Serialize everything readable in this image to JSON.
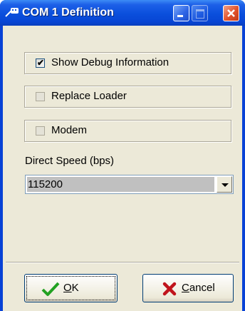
{
  "window": {
    "title": "COM 1 Definition"
  },
  "options": [
    {
      "label": "Show Debug Information",
      "checked": true,
      "enabled": true
    },
    {
      "label": "Replace Loader",
      "checked": false,
      "enabled": false
    },
    {
      "label": "Modem",
      "checked": false,
      "enabled": false
    }
  ],
  "speed": {
    "label": "Direct Speed (bps)",
    "value": "115200"
  },
  "buttons": {
    "ok": {
      "label_accel": "O",
      "label_rest": "K"
    },
    "cancel": {
      "label_accel": "C",
      "label_rest": "ancel"
    }
  },
  "colors": {
    "titlebar": "#0a4fdc",
    "face": "#ece9d8",
    "check": "#21a121",
    "cancel_x": "#c0141c"
  },
  "icons": {
    "app": "serial-port-icon",
    "ok": "checkmark-icon",
    "cancel": "x-icon"
  }
}
